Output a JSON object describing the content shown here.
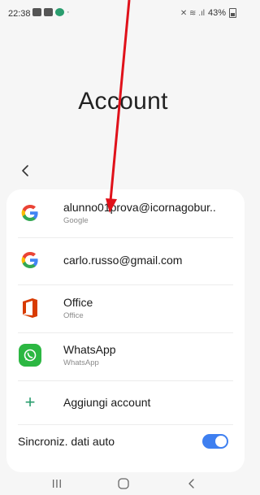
{
  "status_bar": {
    "time": "22:38",
    "dot": "·",
    "signal_glyphs": "✕ ≋ .ıl",
    "battery_percent": "43%"
  },
  "page": {
    "title": "Account"
  },
  "accounts": [
    {
      "primary": "alunno01prova@icornagobur..",
      "secondary": "Google",
      "icon": "google-icon"
    },
    {
      "primary": "carlo.russo@gmail.com",
      "secondary": "",
      "icon": "google-icon"
    },
    {
      "primary": "Office",
      "secondary": "Office",
      "icon": "office-icon"
    },
    {
      "primary": "WhatsApp",
      "secondary": "WhatsApp",
      "icon": "whatsapp-icon"
    }
  ],
  "add_account": {
    "label": "Aggiungi account",
    "icon": "plus-icon"
  },
  "auto_sync": {
    "label": "Sincroniz. dati auto",
    "enabled": true
  },
  "colors": {
    "accent": "#3e7ff0",
    "arrow": "#e0111a",
    "whatsapp": "#2cb742",
    "office": "#d83b01"
  },
  "nav": {
    "recents": "recents-icon",
    "home": "home-icon",
    "back": "back-icon"
  }
}
